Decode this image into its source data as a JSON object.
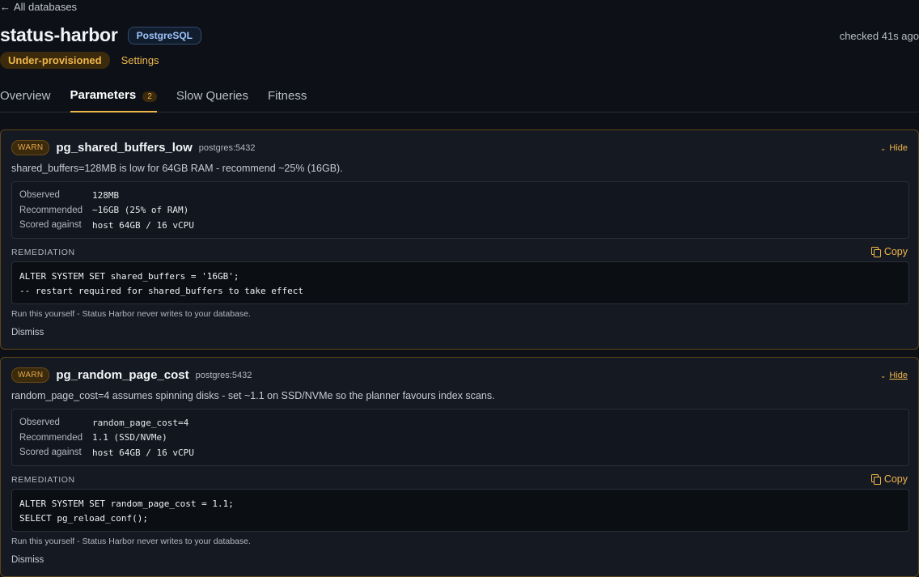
{
  "nav": {
    "back_arrow": "←",
    "back_label": "All databases"
  },
  "header": {
    "title": "status-harbor",
    "engine": "PostgreSQL",
    "checked": "checked 41s ago",
    "status": "Under-provisioned",
    "settings": "Settings"
  },
  "tabs": [
    {
      "label": "Overview",
      "count": null
    },
    {
      "label": "Parameters",
      "count": "2"
    },
    {
      "label": "Slow Queries",
      "count": null
    },
    {
      "label": "Fitness",
      "count": null
    }
  ],
  "findings": [
    {
      "severity": "WARN",
      "name": "pg_shared_buffers_low",
      "host": "postgres:5432",
      "hide": "Hide",
      "description": "shared_buffers=128MB is low for 64GB RAM - recommend ~25% (16GB).",
      "metrics": [
        {
          "label": "Observed",
          "value": "128MB"
        },
        {
          "label": "Recommended",
          "value": "~16GB (25% of RAM)"
        },
        {
          "label": "Scored against",
          "value": "host 64GB / 16 vCPU"
        }
      ],
      "remediation_label": "REMEDIATION",
      "copy": "Copy",
      "code": [
        "ALTER SYSTEM SET shared_buffers = '16GB';",
        "-- restart required for shared_buffers to take effect"
      ],
      "note": "Run this yourself - Status Harbor never writes to your database.",
      "dismiss": "Dismiss"
    },
    {
      "severity": "WARN",
      "name": "pg_random_page_cost",
      "host": "postgres:5432",
      "hide": "Hide",
      "description": "random_page_cost=4 assumes spinning disks - set ~1.1 on SSD/NVMe so the planner favours index scans.",
      "metrics": [
        {
          "label": "Observed",
          "value": "random_page_cost=4"
        },
        {
          "label": "Recommended",
          "value": "1.1 (SSD/NVMe)"
        },
        {
          "label": "Scored against",
          "value": "host 64GB / 16 vCPU"
        }
      ],
      "remediation_label": "REMEDIATION",
      "copy": "Copy",
      "code": [
        "ALTER SYSTEM SET random_page_cost = 1.1;",
        "SELECT pg_reload_conf();"
      ],
      "note": "Run this yourself - Status Harbor never writes to your database.",
      "dismiss": "Dismiss"
    }
  ],
  "colors": {
    "accent": "#f0b64a",
    "background": "#0d1117",
    "card": "#151922",
    "engine": "#9ec5ff"
  },
  "icons": {
    "back": "arrow-left-icon",
    "hide": "chevron-down-icon",
    "copy": "copy-icon"
  }
}
